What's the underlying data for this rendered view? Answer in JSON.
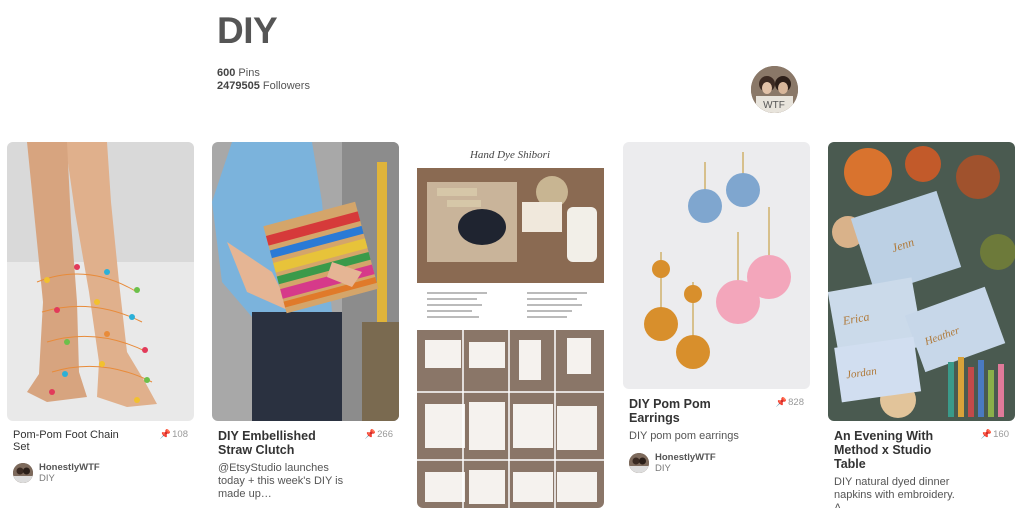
{
  "board": {
    "title": "DIY",
    "pin_count": "600",
    "pins_label": "Pins",
    "follower_count": "2479505",
    "followers_label": "Followers"
  },
  "pins": [
    {
      "title": "Pom-Pom Foot Chain Set",
      "repins": "108",
      "attribution_name": "HonestlyWTF",
      "attribution_board": "DIY"
    },
    {
      "title": "DIY Embellished Straw Clutch",
      "repins": "266",
      "description": "@EtsyStudio launches today + this week's DIY is made up…"
    },
    {
      "image_heading": "Hand Dye Shibori"
    },
    {
      "title": "DIY Pom Pom Earrings",
      "repins": "828",
      "description": "DIY pom pom earrings",
      "attribution_name": "HonestlyWTF",
      "attribution_board": "DIY"
    },
    {
      "title": "An Evening With Method x Studio Table",
      "repins": "160",
      "description": "DIY natural dyed dinner napkins with embroidery. A"
    }
  ],
  "colors": {
    "accent": "#e60023",
    "text": "#333333",
    "muted": "#999999"
  },
  "icons": [
    "pin-icon"
  ]
}
